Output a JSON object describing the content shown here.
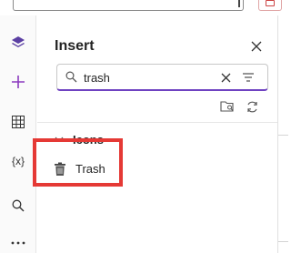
{
  "panel": {
    "title": "Insert",
    "close_icon": "close-icon"
  },
  "search": {
    "value": "trash",
    "placeholder": "Search"
  },
  "group": {
    "label": "Icons",
    "expanded": true
  },
  "items": [
    {
      "label": "Trash",
      "icon": "trash-icon"
    }
  ],
  "rail": [
    {
      "icon": "layers-icon"
    },
    {
      "icon": "plus-icon"
    },
    {
      "icon": "table-icon"
    },
    {
      "icon": "variables-icon",
      "text": "{x}"
    },
    {
      "icon": "search-icon"
    },
    {
      "icon": "more-icon"
    }
  ],
  "colors": {
    "accent": "#6f42c1",
    "highlight": "#e53935",
    "rail_accent": "#5b3fa3",
    "plus": "#8b3bbf"
  }
}
